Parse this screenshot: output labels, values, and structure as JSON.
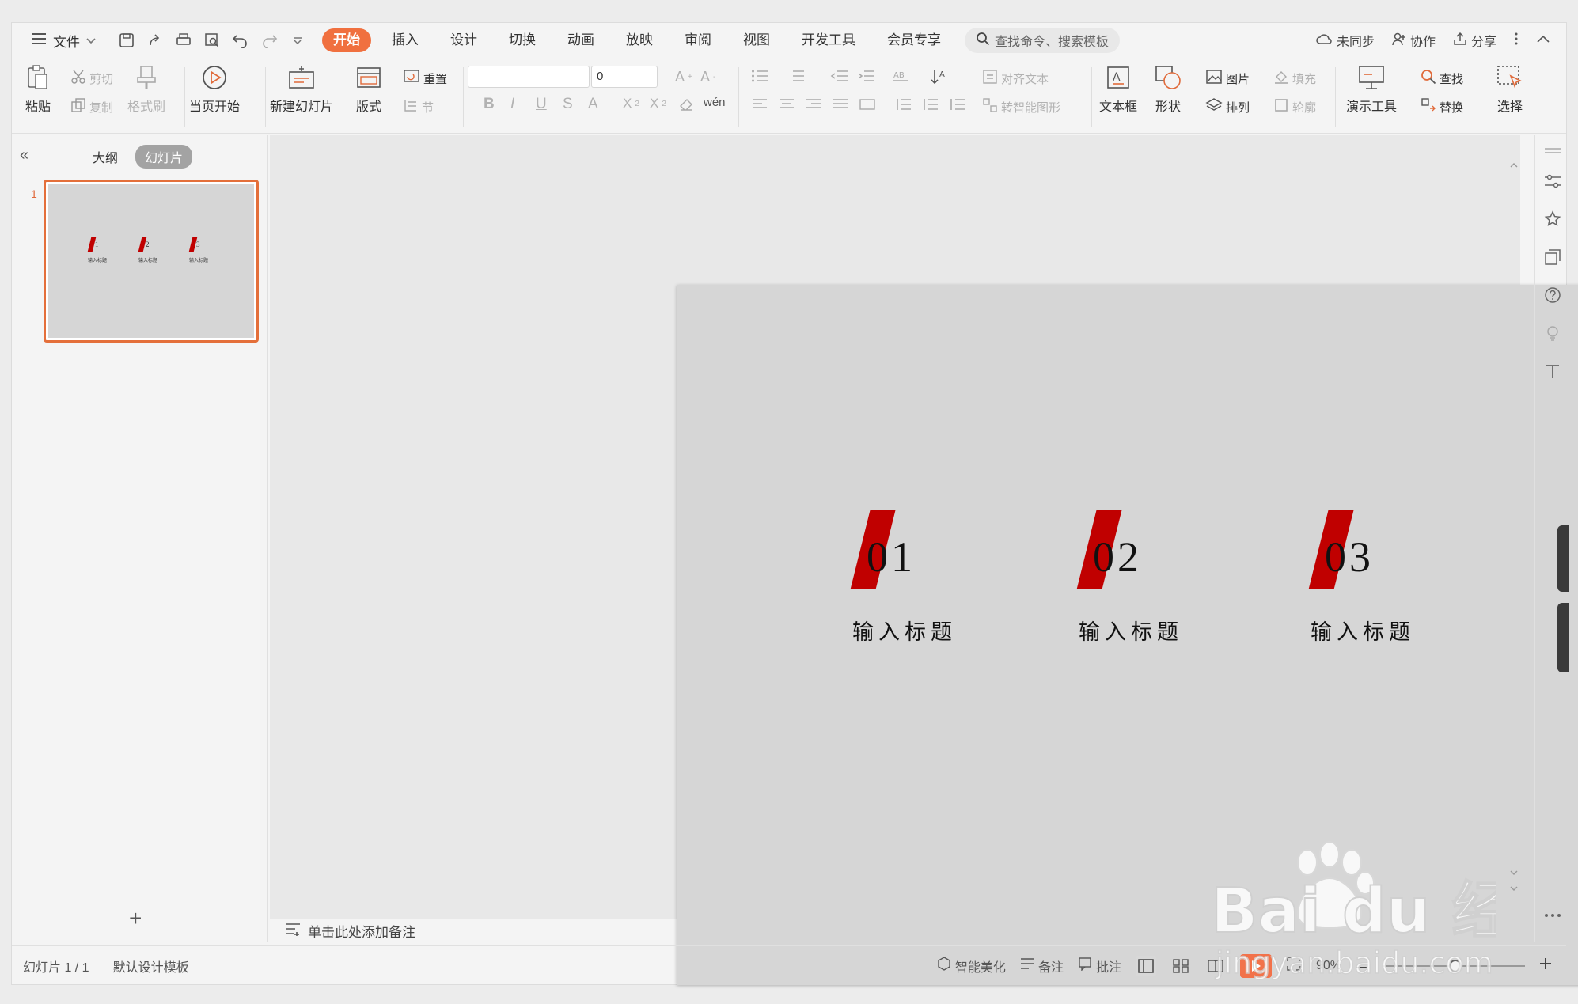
{
  "menubar": {
    "file_label": "文件",
    "tabs": [
      "开始",
      "插入",
      "设计",
      "切换",
      "动画",
      "放映",
      "审阅",
      "视图",
      "开发工具",
      "会员专享"
    ],
    "search_placeholder": "查找命令、搜索模板",
    "right": {
      "sync": "未同步",
      "collab": "协作",
      "share": "分享"
    }
  },
  "ribbon": {
    "paste": "粘贴",
    "cut": "剪切",
    "copy": "复制",
    "format_painter": "格式刷",
    "play_from_current": "当页开始",
    "new_slide": "新建幻灯片",
    "layout": "版式",
    "reset": "重置",
    "section": "节",
    "font_size": "0",
    "align_text": "对齐文本",
    "smart_shape": "转智能图形",
    "textbox": "文本框",
    "shape": "形状",
    "picture": "图片",
    "fill": "填充",
    "arrange": "排列",
    "outline": "轮廓",
    "present_tools": "演示工具",
    "find": "查找",
    "replace": "替换",
    "select": "选择"
  },
  "leftpanel": {
    "tab_outline": "大纲",
    "tab_slides": "幻灯片",
    "slide_number": "1",
    "add": "+"
  },
  "slide": {
    "items": [
      {
        "num": "01",
        "caption": "输入标题"
      },
      {
        "num": "02",
        "caption": "输入标题"
      },
      {
        "num": "03",
        "caption": "输入标题"
      }
    ],
    "accent_color": "#c00000",
    "background": "#d6d6d6"
  },
  "thumbnail": {
    "items": [
      {
        "num": "1",
        "caption": "输入标题"
      },
      {
        "num": "2",
        "caption": "输入标题"
      },
      {
        "num": "3",
        "caption": "输入标题"
      }
    ]
  },
  "notes_placeholder": "单击此处添加备注",
  "statusbar": {
    "slide_index": "幻灯片 1 / 1",
    "template": "默认设计模板",
    "beautify": "智能美化",
    "notes": "备注",
    "comments": "批注",
    "zoom": "90%"
  },
  "watermark": {
    "brand": "Bai du 经验",
    "url": "jingyan.baidu.com"
  }
}
